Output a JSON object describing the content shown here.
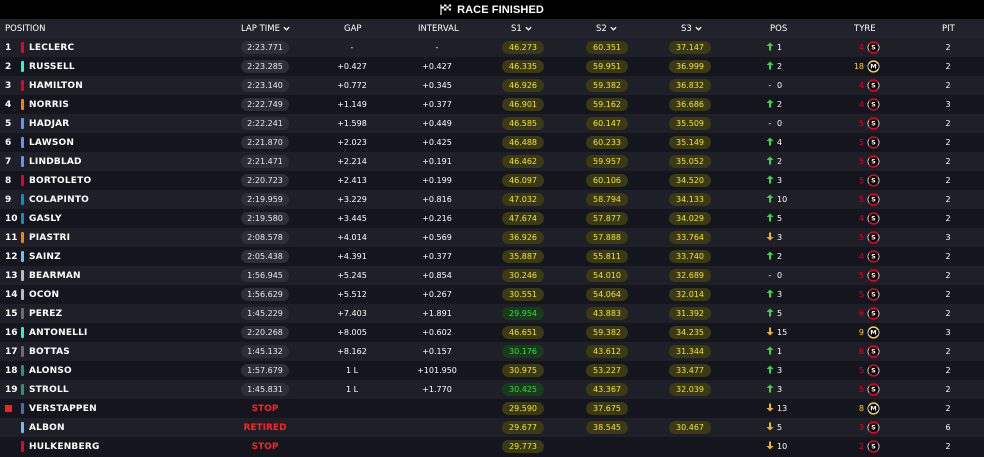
{
  "header_bar": {
    "title": "RACE FINISHED",
    "icon": "checkered-flag-icon"
  },
  "columns": {
    "position": "POSITION",
    "lap_time": "LAP TIME",
    "gap": "GAP",
    "interval": "INTERVAL",
    "s1": "S1",
    "s2": "S2",
    "s3": "S3",
    "pos": "POS",
    "tyre": "TYRE",
    "pit": "PIT"
  },
  "colors": {
    "sector_yellow": "#f5e23a",
    "sector_green": "#3dd647",
    "gain_arrow": "#3dd647",
    "loss_arrow": "#f5b323",
    "soft_tyre": "#e8002d",
    "medium_tyre": "#ffd12e",
    "stop_text": "#ff2222"
  },
  "rows": [
    {
      "pos": "1",
      "driver": "LECLERC",
      "team_color": "#e8002d",
      "lap_time": "2:23.771",
      "gap": "-",
      "interval": "-",
      "s1": "46.273",
      "s1c": "yellow",
      "s2": "60.351",
      "s2c": "yellow",
      "s3": "37.147",
      "s3c": "yellow",
      "delta": "1",
      "dir": "up",
      "tyre_age": "4",
      "tyre": "S",
      "pit": "2"
    },
    {
      "pos": "2",
      "driver": "RUSSELL",
      "team_color": "#27f4d2",
      "lap_time": "2:23.285",
      "gap": "+0.427",
      "interval": "+0.427",
      "s1": "46.335",
      "s1c": "yellow",
      "s2": "59.951",
      "s2c": "yellow",
      "s3": "36.999",
      "s3c": "yellow",
      "delta": "2",
      "dir": "up",
      "tyre_age": "18",
      "tyre": "M",
      "pit": "2"
    },
    {
      "pos": "3",
      "driver": "HAMILTON",
      "team_color": "#e8002d",
      "lap_time": "2:23.140",
      "gap": "+0.772",
      "interval": "+0.345",
      "s1": "46.926",
      "s1c": "yellow",
      "s2": "59.382",
      "s2c": "yellow",
      "s3": "36.832",
      "s3c": "yellow",
      "delta": "0",
      "dir": "none",
      "tyre_age": "4",
      "tyre": "S",
      "pit": "2"
    },
    {
      "pos": "4",
      "driver": "NORRIS",
      "team_color": "#ff8000",
      "lap_time": "2:22.749",
      "gap": "+1.149",
      "interval": "+0.377",
      "s1": "46.901",
      "s1c": "yellow",
      "s2": "59.162",
      "s2c": "yellow",
      "s3": "36.686",
      "s3c": "yellow",
      "delta": "2",
      "dir": "up",
      "tyre_age": "4",
      "tyre": "S",
      "pit": "3"
    },
    {
      "pos": "5",
      "driver": "HADJAR",
      "team_color": "#6692ff",
      "lap_time": "2:22.241",
      "gap": "+1.598",
      "interval": "+0.449",
      "s1": "46.585",
      "s1c": "yellow",
      "s2": "60.147",
      "s2c": "yellow",
      "s3": "35.509",
      "s3c": "yellow",
      "delta": "0",
      "dir": "none",
      "tyre_age": "5",
      "tyre": "S",
      "pit": "2"
    },
    {
      "pos": "6",
      "driver": "LAWSON",
      "team_color": "#6692ff",
      "lap_time": "2:21.870",
      "gap": "+2.023",
      "interval": "+0.425",
      "s1": "46.488",
      "s1c": "yellow",
      "s2": "60.233",
      "s2c": "yellow",
      "s3": "35.149",
      "s3c": "yellow",
      "delta": "4",
      "dir": "up",
      "tyre_age": "5",
      "tyre": "S",
      "pit": "2"
    },
    {
      "pos": "7",
      "driver": "LINDBLAD",
      "team_color": "#6692ff",
      "lap_time": "2:21.471",
      "gap": "+2.214",
      "interval": "+0.191",
      "s1": "46.462",
      "s1c": "yellow",
      "s2": "59.957",
      "s2c": "yellow",
      "s3": "35.052",
      "s3c": "yellow",
      "delta": "2",
      "dir": "up",
      "tyre_age": "5",
      "tyre": "S",
      "pit": "2"
    },
    {
      "pos": "8",
      "driver": "BORTOLETO",
      "team_color": "#e8002d",
      "lap_time": "2:20.723",
      "gap": "+2.413",
      "interval": "+0.199",
      "s1": "46.097",
      "s1c": "yellow",
      "s2": "60.106",
      "s2c": "yellow",
      "s3": "34.520",
      "s3c": "yellow",
      "delta": "3",
      "dir": "up",
      "tyre_age": "5",
      "tyre": "S",
      "pit": "2"
    },
    {
      "pos": "9",
      "driver": "COLAPINTO",
      "team_color": "#0093cc",
      "lap_time": "2:19.959",
      "gap": "+3.229",
      "interval": "+0.816",
      "s1": "47.032",
      "s1c": "yellow",
      "s2": "58.794",
      "s2c": "yellow",
      "s3": "34.133",
      "s3c": "yellow",
      "delta": "10",
      "dir": "up",
      "tyre_age": "5",
      "tyre": "S",
      "pit": "2"
    },
    {
      "pos": "10",
      "driver": "GASLY",
      "team_color": "#0093cc",
      "lap_time": "2:19.580",
      "gap": "+3.445",
      "interval": "+0.216",
      "s1": "47.674",
      "s1c": "yellow",
      "s2": "57.877",
      "s2c": "yellow",
      "s3": "34.029",
      "s3c": "yellow",
      "delta": "5",
      "dir": "up",
      "tyre_age": "4",
      "tyre": "S",
      "pit": "2"
    },
    {
      "pos": "11",
      "driver": "PIASTRI",
      "team_color": "#ff8000",
      "lap_time": "2:08.578",
      "gap": "+4.014",
      "interval": "+0.569",
      "s1": "36.926",
      "s1c": "yellow",
      "s2": "57.888",
      "s2c": "yellow",
      "s3": "33.764",
      "s3c": "yellow",
      "delta": "3",
      "dir": "down",
      "tyre_age": "5",
      "tyre": "S",
      "pit": "3"
    },
    {
      "pos": "12",
      "driver": "SAINZ",
      "team_color": "#64c4ff",
      "lap_time": "2:05.438",
      "gap": "+4.391",
      "interval": "+0.377",
      "s1": "35.887",
      "s1c": "yellow",
      "s2": "55.811",
      "s2c": "yellow",
      "s3": "33.740",
      "s3c": "yellow",
      "delta": "2",
      "dir": "up",
      "tyre_age": "4",
      "tyre": "S",
      "pit": "2"
    },
    {
      "pos": "13",
      "driver": "BEARMAN",
      "team_color": "#b6babd",
      "lap_time": "1:56.945",
      "gap": "+5.245",
      "interval": "+0.854",
      "s1": "30.246",
      "s1c": "yellow",
      "s2": "54.010",
      "s2c": "yellow",
      "s3": "32.689",
      "s3c": "yellow",
      "delta": "0",
      "dir": "none",
      "tyre_age": "5",
      "tyre": "S",
      "pit": "2"
    },
    {
      "pos": "14",
      "driver": "OCON",
      "team_color": "#b6babd",
      "lap_time": "1:56.629",
      "gap": "+5.512",
      "interval": "+0.267",
      "s1": "30.551",
      "s1c": "yellow",
      "s2": "54.064",
      "s2c": "yellow",
      "s3": "32.014",
      "s3c": "yellow",
      "delta": "3",
      "dir": "up",
      "tyre_age": "5",
      "tyre": "S",
      "pit": "2"
    },
    {
      "pos": "15",
      "driver": "PEREZ",
      "team_color": "#6c6c6c",
      "lap_time": "1:45.229",
      "gap": "+7.403",
      "interval": "+1.891",
      "s1": "29.954",
      "s1c": "green",
      "s2": "43.883",
      "s2c": "yellow",
      "s3": "31.392",
      "s3c": "yellow",
      "delta": "5",
      "dir": "up",
      "tyre_age": "6",
      "tyre": "S",
      "pit": "2"
    },
    {
      "pos": "16",
      "driver": "ANTONELLI",
      "team_color": "#27f4d2",
      "lap_time": "2:20.268",
      "gap": "+8.005",
      "interval": "+0.602",
      "s1": "46.651",
      "s1c": "yellow",
      "s2": "59.382",
      "s2c": "yellow",
      "s3": "34.235",
      "s3c": "yellow",
      "delta": "15",
      "dir": "down",
      "tyre_age": "9",
      "tyre": "M",
      "pit": "3"
    },
    {
      "pos": "17",
      "driver": "BOTTAS",
      "team_color": "#6c6c6c",
      "lap_time": "1:45.132",
      "gap": "+8.162",
      "interval": "+0.157",
      "s1": "30.176",
      "s1c": "green",
      "s2": "43.612",
      "s2c": "yellow",
      "s3": "31.344",
      "s3c": "yellow",
      "delta": "1",
      "dir": "up",
      "tyre_age": "6",
      "tyre": "S",
      "pit": "2"
    },
    {
      "pos": "18",
      "driver": "ALONSO",
      "team_color": "#229971",
      "lap_time": "1:57.679",
      "gap": "1 L",
      "interval": "+101.950",
      "s1": "30.975",
      "s1c": "yellow",
      "s2": "53.227",
      "s2c": "yellow",
      "s3": "33.477",
      "s3c": "yellow",
      "delta": "3",
      "dir": "up",
      "tyre_age": "5",
      "tyre": "S",
      "pit": "2"
    },
    {
      "pos": "19",
      "driver": "STROLL",
      "team_color": "#229971",
      "lap_time": "1:45.831",
      "gap": "1 L",
      "interval": "+1.770",
      "s1": "30.425",
      "s1c": "green",
      "s2": "43.367",
      "s2c": "yellow",
      "s3": "32.039",
      "s3c": "yellow",
      "delta": "3",
      "dir": "up",
      "tyre_age": "5",
      "tyre": "S",
      "pit": "2"
    },
    {
      "pos": "",
      "driver": "VERSTAPPEN",
      "team_color": "#3671c6",
      "status": "STOP",
      "s1": "29.590",
      "s1c": "yellow",
      "s2": "37.675",
      "s2c": "yellow",
      "s3": "",
      "s3c": "yellow",
      "delta": "13",
      "dir": "down",
      "tyre_age": "8",
      "tyre": "M",
      "pit": "2",
      "out": true
    },
    {
      "pos": "",
      "driver": "ALBON",
      "team_color": "#64c4ff",
      "status": "RETIRED",
      "s1": "29.677",
      "s1c": "yellow",
      "s2": "38.545",
      "s2c": "yellow",
      "s3": "30.467",
      "s3c": "yellow",
      "delta": "5",
      "dir": "down",
      "tyre_age": "3",
      "tyre": "S",
      "pit": "6"
    },
    {
      "pos": "",
      "driver": "HULKENBERG",
      "team_color": "#e8002d",
      "status": "STOP",
      "s1": "29.773",
      "s1c": "yellow",
      "s2": "",
      "s2c": "yellow",
      "s3": "",
      "s3c": "yellow",
      "delta": "10",
      "dir": "down",
      "tyre_age": "2",
      "tyre": "S",
      "pit": "2"
    }
  ]
}
